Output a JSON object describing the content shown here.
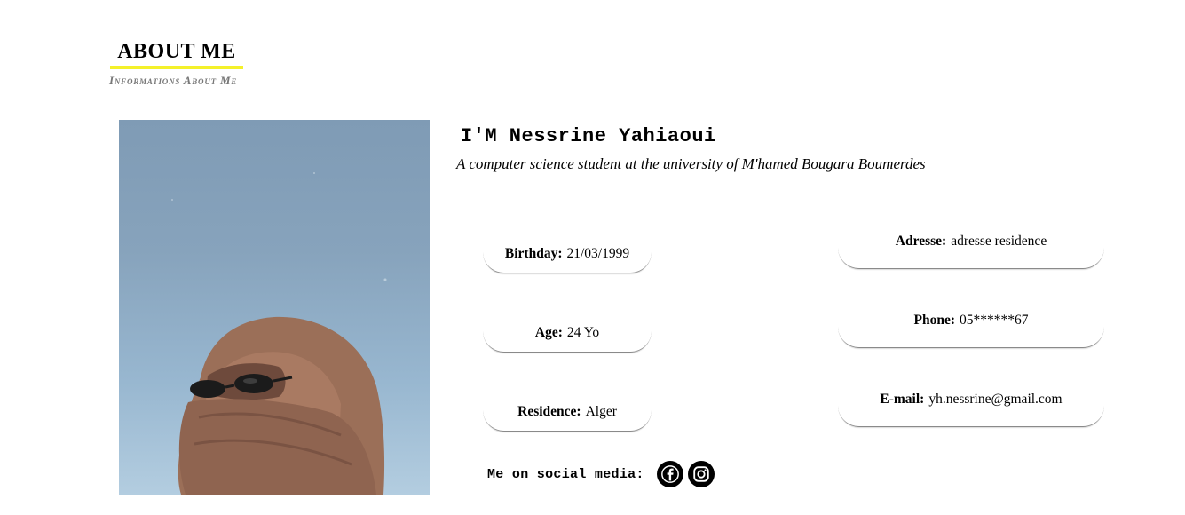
{
  "section": {
    "title": "ABOUT ME",
    "subtitle": "Informations About Me"
  },
  "profile": {
    "name": "I'M Nessrine Yahiaoui",
    "tagline": "A computer science student at the university of M'hamed Bougara Boumerdes"
  },
  "info_left": [
    {
      "key": "Birthday:",
      "value": "21/03/1999"
    },
    {
      "key": "Age:",
      "value": "24 Yo"
    },
    {
      "key": "Residence:",
      "value": "Alger"
    }
  ],
  "info_right": [
    {
      "key": "Adresse:",
      "value": "adresse residence"
    },
    {
      "key": "Phone:",
      "value": "05******67"
    },
    {
      "key": "E-mail:",
      "value": "yh.nessrine@gmail.com"
    }
  ],
  "social": {
    "label": "Me on social media:",
    "icons": [
      "facebook-icon",
      "instagram-icon"
    ]
  },
  "colors": {
    "accent_underline": "#f4f12a",
    "subtitle_gray": "#777777"
  }
}
